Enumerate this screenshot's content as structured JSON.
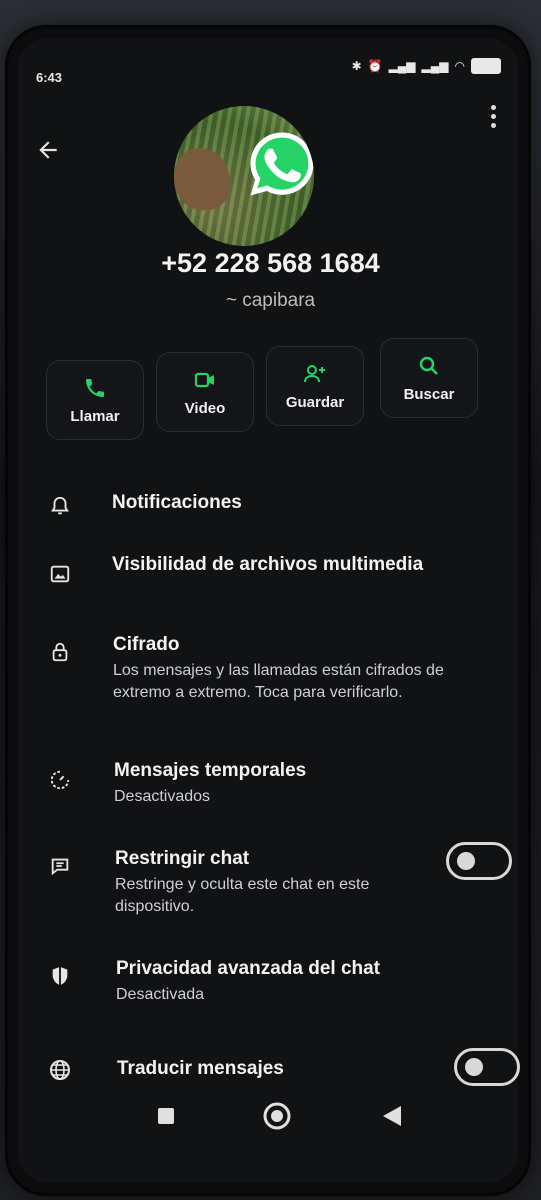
{
  "status_bar": {
    "time": "6:43",
    "icons": [
      "bluetooth-icon",
      "alarm-icon",
      "signal-icon",
      "signal-icon",
      "wifi-icon",
      "battery-icon"
    ]
  },
  "contact": {
    "phone_number": "+52 228 568 1684",
    "username": "~ capibara"
  },
  "actions": [
    {
      "label": "Llamar",
      "icon": "phone-icon"
    },
    {
      "label": "Video",
      "icon": "video-icon"
    },
    {
      "label": "Guardar",
      "icon": "add-contact-icon"
    },
    {
      "label": "Buscar",
      "icon": "search-icon"
    }
  ],
  "settings": {
    "notifications": {
      "title": "Notificaciones",
      "icon": "bell-icon"
    },
    "media_visibility": {
      "title": "Visibilidad de archivos multimedia",
      "icon": "image-icon"
    },
    "encryption": {
      "title": "Cifrado",
      "subtitle": "Los mensajes y las llamadas están cifrados de extremo a extremo. Toca para verificarlo.",
      "icon": "lock-icon"
    },
    "disappearing": {
      "title": "Mensajes temporales",
      "subtitle": "Desactivados",
      "icon": "timer-icon"
    },
    "restrict": {
      "title": "Restringir chat",
      "subtitle": "Restringe y oculta este chat en este dispositivo.",
      "icon": "chat-lock-icon",
      "enabled": false
    },
    "privacy": {
      "title": "Privacidad avanzada del chat",
      "subtitle": "Desactivada",
      "icon": "shield-icon"
    },
    "translate": {
      "title": "Traducir mensajes",
      "icon": "globe-icon",
      "enabled": false
    }
  },
  "colors": {
    "accent": "#25d366",
    "background": "#111214",
    "text": "#f3f3f3"
  }
}
